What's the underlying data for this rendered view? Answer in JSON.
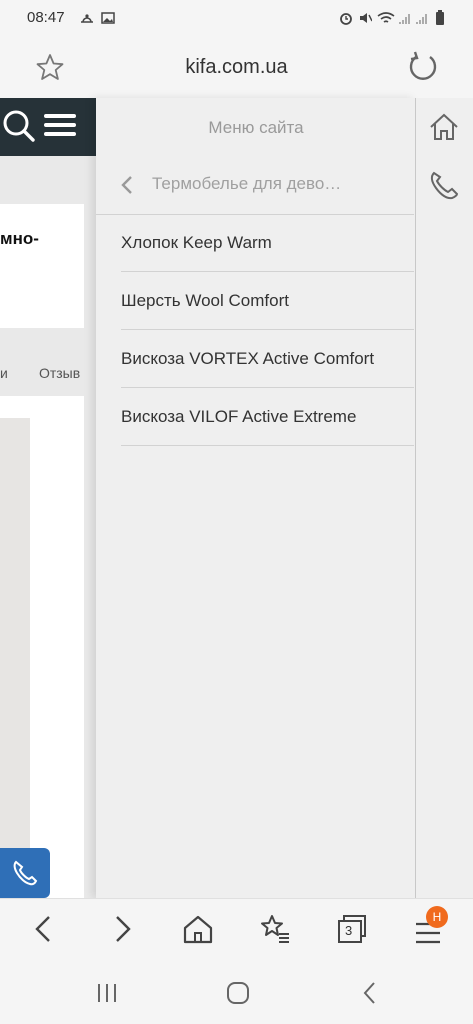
{
  "status_bar": {
    "time": "08:47",
    "left_icons": [
      "weather-icon",
      "image-icon"
    ],
    "right_icons": [
      "alarm-icon",
      "mute-icon",
      "wifi-icon",
      "signal-icon",
      "signal-icon",
      "battery-icon"
    ]
  },
  "browser": {
    "url": "kifa.com.ua",
    "tab_count": "3",
    "menu_badge": "H"
  },
  "background_page": {
    "snippet_text": "мно-",
    "tabs_text": "и        Отзыв"
  },
  "side_menu": {
    "title": "Меню сайта",
    "back_label": "Термобелье для дево…",
    "items": [
      {
        "label": "Хлопок Keep Warm"
      },
      {
        "label": "Шерсть Wool Comfort"
      },
      {
        "label": "Вискоза VORTEX Active Comfort"
      },
      {
        "label": "Вискоза VILOF Active Extreme"
      }
    ]
  },
  "colors": {
    "header_dark": "#263238",
    "call_button": "#2f6fb7",
    "badge": "#f06a1d"
  }
}
